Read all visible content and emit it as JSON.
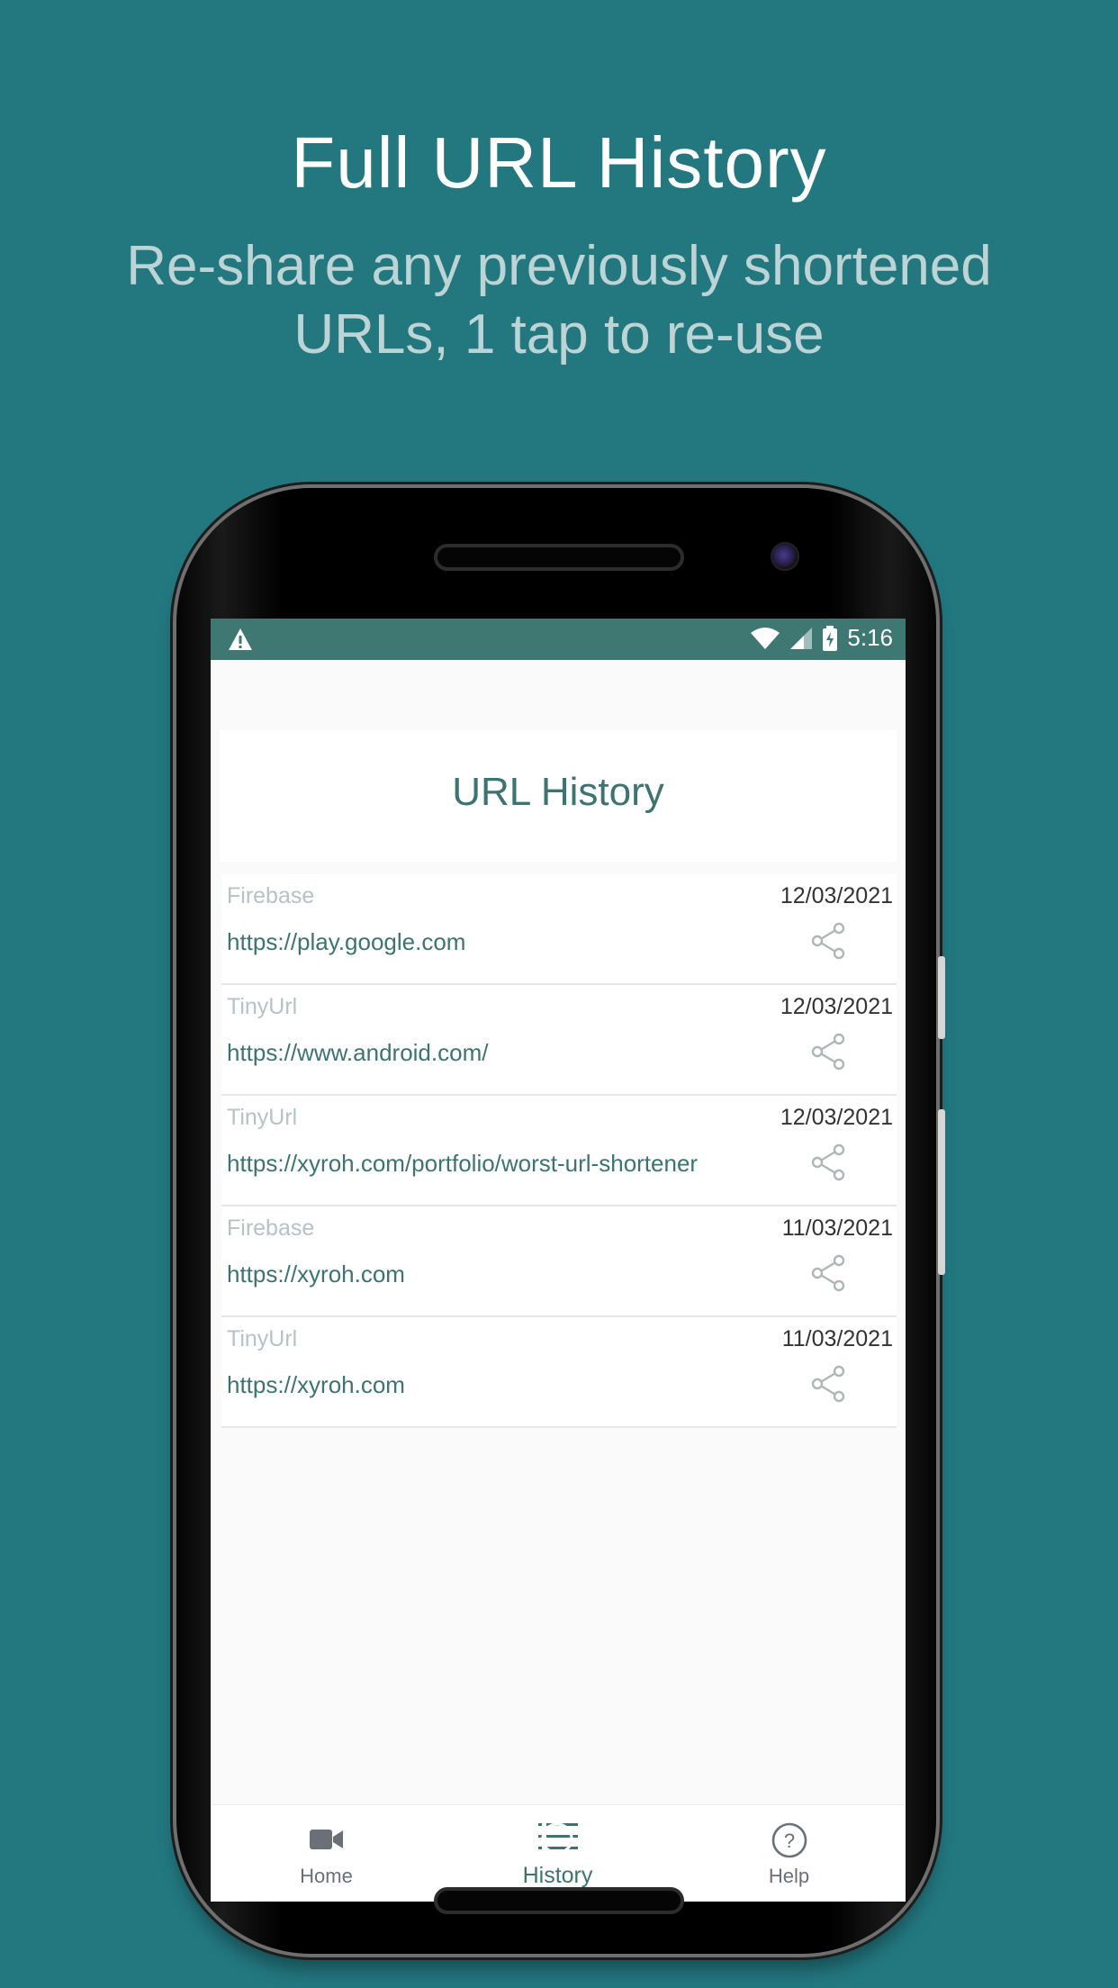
{
  "promo": {
    "headline": "Full URL History",
    "subline_1": "Re-share any previously shortened",
    "subline_2": "URLs, 1 tap to re-use"
  },
  "status_bar": {
    "time": "5:16",
    "icons": [
      "warning-icon",
      "wifi-icon",
      "signal-icon",
      "battery-charging-icon"
    ]
  },
  "screen": {
    "title": "URL History"
  },
  "history": [
    {
      "service": "Firebase",
      "date": "12/03/2021",
      "url": "https://play.google.com"
    },
    {
      "service": "TinyUrl",
      "date": "12/03/2021",
      "url": "https://www.android.com/"
    },
    {
      "service": "TinyUrl",
      "date": "12/03/2021",
      "url": "https://xyroh.com/portfolio/worst-url-shortener"
    },
    {
      "service": "Firebase",
      "date": "11/03/2021",
      "url": "https://xyroh.com"
    },
    {
      "service": "TinyUrl",
      "date": "11/03/2021",
      "url": "https://xyroh.com"
    }
  ],
  "bottom_nav": {
    "home": "Home",
    "history": "History",
    "help": "Help",
    "active": "history"
  },
  "colors": {
    "background": "#237880",
    "status_bar": "#3f7773",
    "accent": "#3d7370"
  }
}
